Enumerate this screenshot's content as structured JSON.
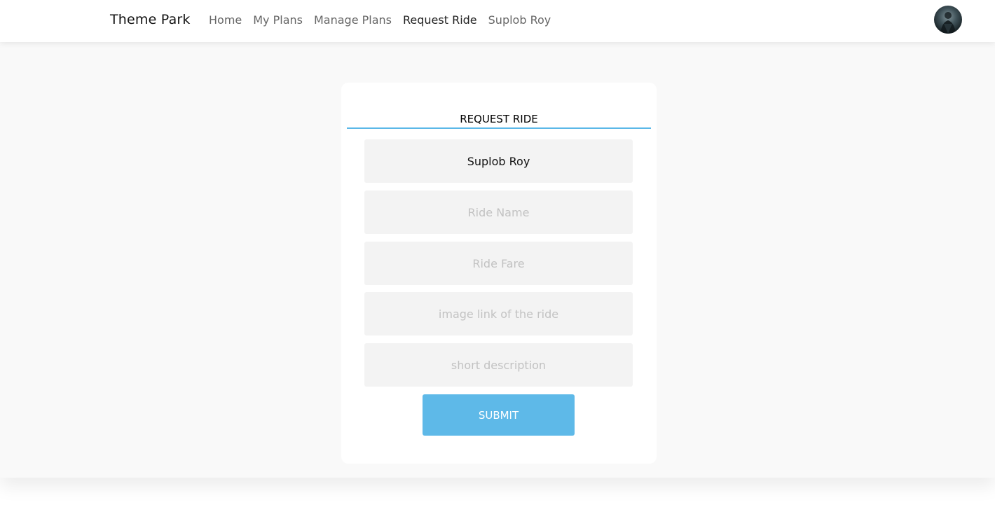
{
  "navbar": {
    "brand": "Theme Park",
    "links": [
      {
        "label": "Home",
        "active": false
      },
      {
        "label": "My Plans",
        "active": false
      },
      {
        "label": "Manage Plans",
        "active": false
      },
      {
        "label": "Request Ride",
        "active": true
      },
      {
        "label": "Suplob Roy",
        "active": false
      }
    ],
    "avatar_icon": "user-avatar-icon"
  },
  "form": {
    "title": "REQUEST RIDE",
    "name_value": "Suplob Roy",
    "ride_name_placeholder": "Ride Name",
    "ride_fare_placeholder": "Ride Fare",
    "image_link_placeholder": "image link of the ride",
    "description_placeholder": "short description",
    "submit_label": "SUBMIT"
  },
  "colors": {
    "accent": "#5eb9e8",
    "page_background": "#f9f9f9",
    "input_background": "#f3f3f3"
  }
}
